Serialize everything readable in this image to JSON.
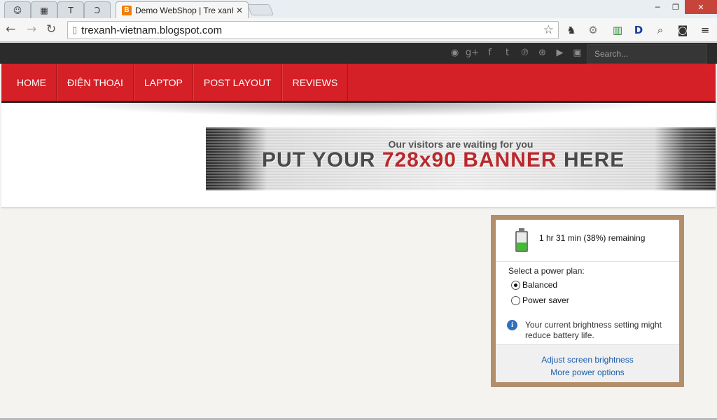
{
  "browser": {
    "tabs": [
      {
        "name": "pinned-1",
        "icon": "ghost-icon"
      },
      {
        "name": "pinned-2",
        "icon": "film-icon"
      },
      {
        "name": "pinned-3",
        "icon": "t-icon"
      },
      {
        "name": "pinned-4",
        "icon": "d-icon"
      }
    ],
    "active_tab": {
      "title": "Demo WebShop | Tre xanh",
      "favicon": "blogger-icon"
    },
    "url": "trexanh-vietnam.blogspot.com",
    "window_buttons": {
      "minimize": "─",
      "maximize": "❐",
      "close": "✕"
    }
  },
  "site": {
    "search_placeholder": "Search...",
    "social_icons": [
      "rss-icon",
      "google-plus-icon",
      "facebook-icon",
      "twitter-icon",
      "pinterest-icon",
      "dribbble-icon",
      "youtube-icon",
      "instagram-icon"
    ],
    "menu": [
      "HOME",
      "ĐIỆN THOẠI",
      "LAPTOP",
      "POST LAYOUT",
      "REVIEWS"
    ],
    "banner": {
      "line1": "Our visitors are waiting for you",
      "line2_a": "PUT YOUR",
      "line2_b": "728x90 BANNER",
      "line2_c": "HERE"
    },
    "accent_color": "#d42026"
  },
  "battery_popup": {
    "status": "1 hr 31 min (38%) remaining",
    "plan_label": "Select a power plan:",
    "plans": [
      {
        "label": "Balanced",
        "selected": true
      },
      {
        "label": "Power saver",
        "selected": false
      }
    ],
    "info": "Your current brightness setting might reduce battery life.",
    "links": [
      "Adjust screen brightness",
      "More power options"
    ]
  }
}
